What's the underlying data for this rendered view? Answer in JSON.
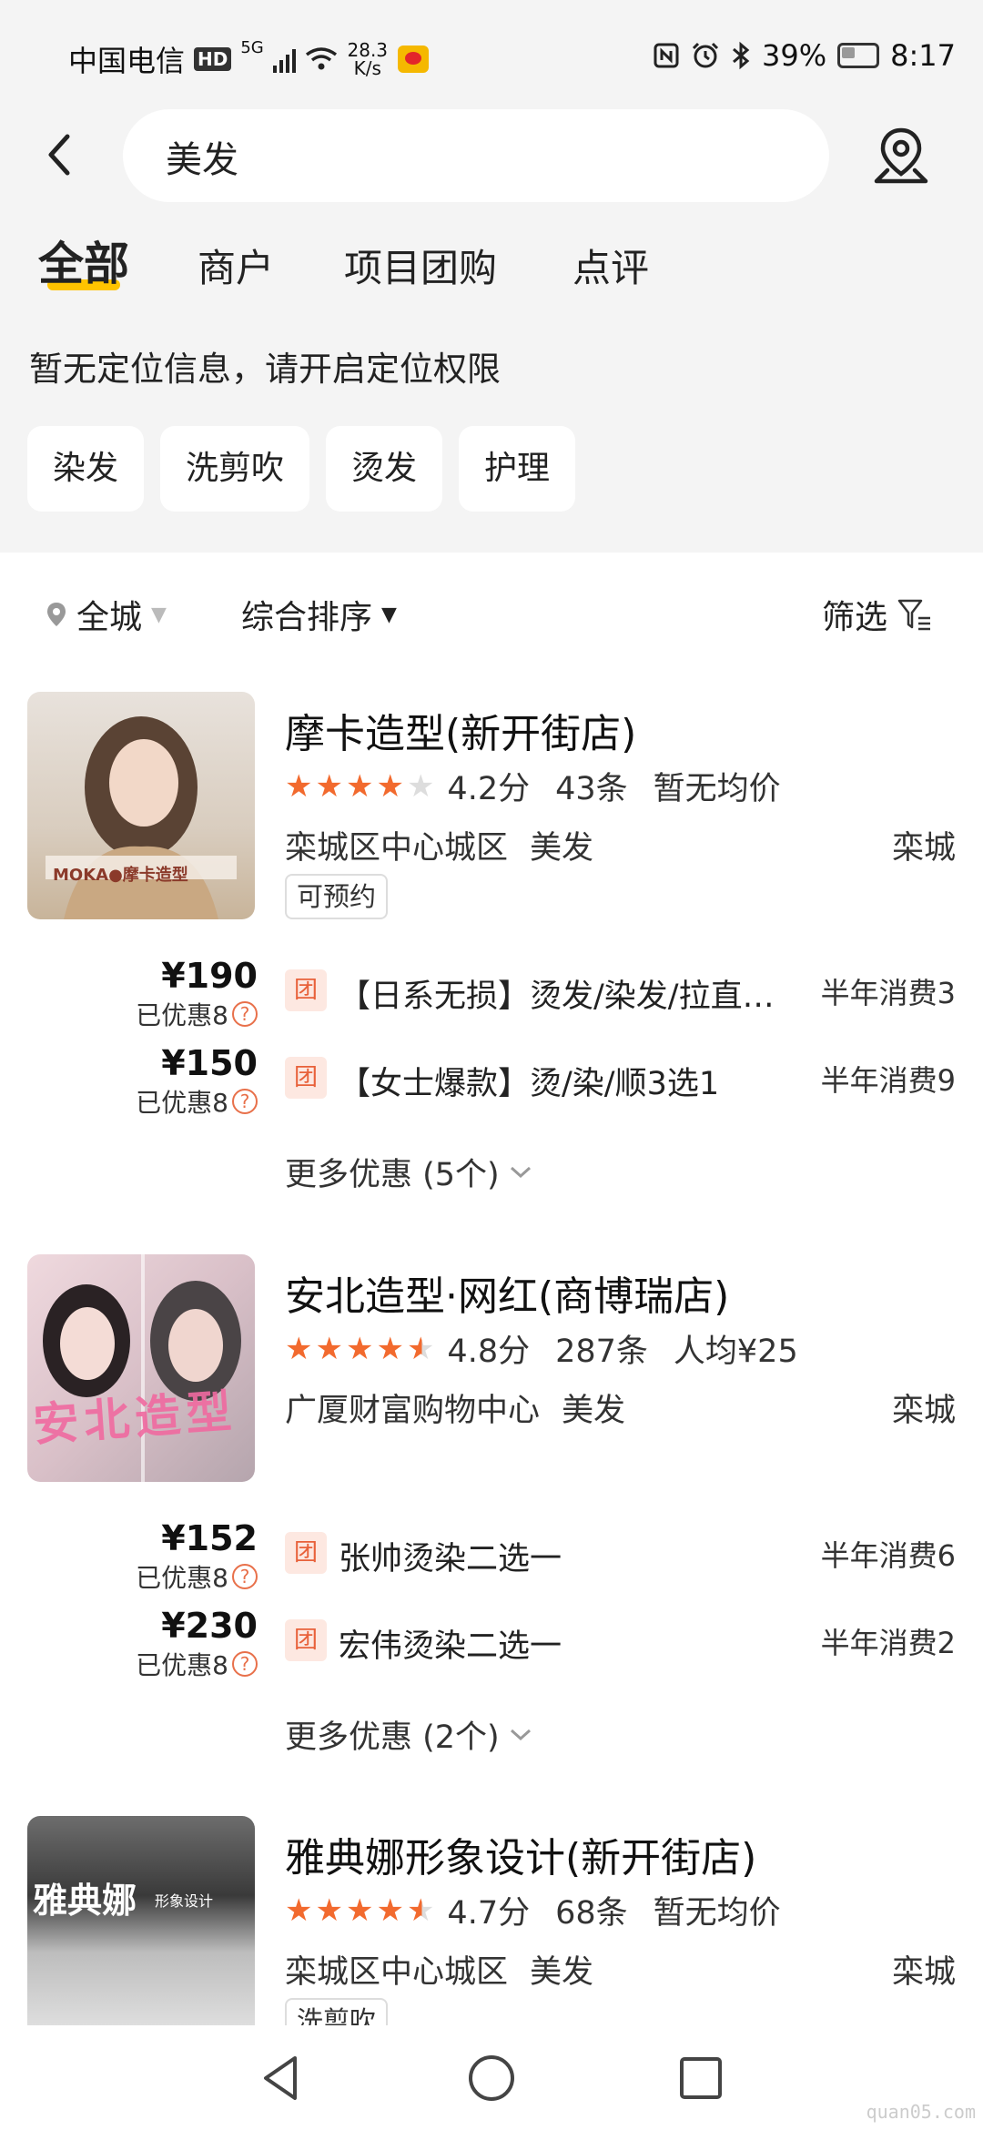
{
  "status_bar": {
    "carrier": "中国电信",
    "hd": "HD",
    "net_type": "5G",
    "net_speed_value": "28.3",
    "net_speed_unit": "K/s",
    "battery": "39%",
    "time": "8:17"
  },
  "search": {
    "value": "美发"
  },
  "tabs": [
    {
      "label": "全部",
      "active": true
    },
    {
      "label": "商户",
      "active": false
    },
    {
      "label": "项目团购",
      "active": false
    },
    {
      "label": "点评",
      "active": false
    }
  ],
  "location_hint": "暂无定位信息，请开启定位权限",
  "chips": [
    "染发",
    "洗剪吹",
    "烫发",
    "护理"
  ],
  "filter_bar": {
    "area": "全城",
    "sort": "综合排序",
    "filter": "筛选"
  },
  "shops": [
    {
      "name": "摩卡造型(新开街店)",
      "rating": 4.2,
      "score": "4.2分",
      "reviews": "43条",
      "avg_price": "暂无均价",
      "district": "栾城区中心城区",
      "category": "美发",
      "city": "栾城",
      "tag": "可预约",
      "thumb_text": "MOKA●摩卡造型",
      "deals": [
        {
          "price": "¥190",
          "saved": "已优惠8",
          "badge": "团",
          "title": "【日系无损】烫发/染发/拉直…",
          "sold": "半年消费3"
        },
        {
          "price": "¥150",
          "saved": "已优惠8",
          "badge": "团",
          "title": "【女士爆款】烫/染/顺3选1",
          "sold": "半年消费9"
        }
      ],
      "more": "更多优惠 (5个)"
    },
    {
      "name": "安北造型·网红(商博瑞店)",
      "rating": 4.8,
      "score": "4.8分",
      "reviews": "287条",
      "avg_price": "人均¥25",
      "district": "广厦财富购物中心",
      "category": "美发",
      "city": "栾城",
      "tag": "",
      "thumb_text": "安北造型",
      "deals": [
        {
          "price": "¥152",
          "saved": "已优惠8",
          "badge": "团",
          "title": "张帅烫染二选一",
          "sold": "半年消费6"
        },
        {
          "price": "¥230",
          "saved": "已优惠8",
          "badge": "团",
          "title": "宏伟烫染二选一",
          "sold": "半年消费2"
        }
      ],
      "more": "更多优惠 (2个)"
    },
    {
      "name": "雅典娜形象设计(新开街店)",
      "rating": 4.7,
      "score": "4.7分",
      "reviews": "68条",
      "avg_price": "暂无均价",
      "district": "栾城区中心城区",
      "category": "美发",
      "city": "栾城",
      "tag": "洗剪吹",
      "thumb_text": "雅典娜",
      "thumb_subtext": "形象设计",
      "deals": [],
      "more": ""
    }
  ],
  "watermark": "quan05.com",
  "colors": {
    "accent": "#ffc300",
    "star": "#f26a2e",
    "deal_badge": "#e8613a"
  }
}
